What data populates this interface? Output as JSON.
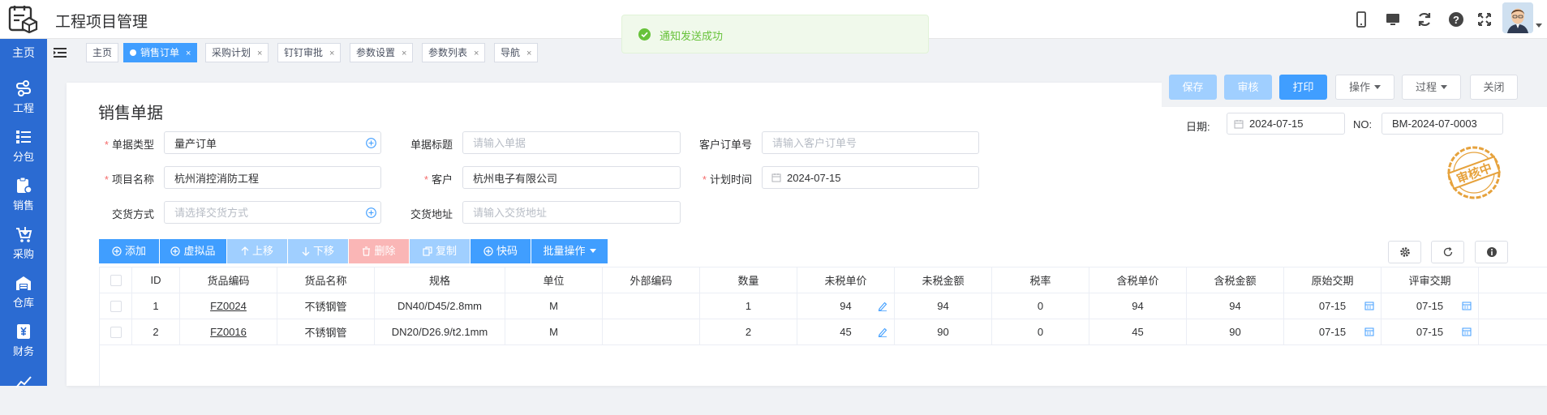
{
  "app": {
    "title": "工程项目管理"
  },
  "toast": {
    "message": "通知发送成功"
  },
  "sidebar": {
    "home": "主页",
    "items": [
      {
        "label": "工程",
        "icon": "project-icon"
      },
      {
        "label": "分包",
        "icon": "subcontract-icon"
      },
      {
        "label": "销售",
        "icon": "sales-icon"
      },
      {
        "label": "采购",
        "icon": "purchase-icon"
      },
      {
        "label": "仓库",
        "icon": "warehouse-icon"
      },
      {
        "label": "财务",
        "icon": "finance-icon"
      }
    ]
  },
  "tabs": [
    {
      "label": "主页",
      "closable": false,
      "active": false
    },
    {
      "label": "销售订单",
      "closable": true,
      "active": true
    },
    {
      "label": "采购计划",
      "closable": true,
      "active": false
    },
    {
      "label": "钉钉审批",
      "closable": true,
      "active": false
    },
    {
      "label": "参数设置",
      "closable": true,
      "active": false
    },
    {
      "label": "参数列表",
      "closable": true,
      "active": false
    },
    {
      "label": "导航",
      "closable": true,
      "active": false
    }
  ],
  "tab_close": "×",
  "actions": {
    "save": "保存",
    "audit": "审核",
    "print": "打印",
    "operate": "操作",
    "process": "过程",
    "close": "关闭"
  },
  "form": {
    "title": "销售单据",
    "doc_type_label": "单据类型",
    "doc_type_value": "量产订单",
    "doc_title_label": "单据标题",
    "doc_title_placeholder": "请输入单据",
    "customer_order_label": "客户订单号",
    "customer_order_placeholder": "请输入客户订单号",
    "project_label": "项目名称",
    "project_value": "杭州消控消防工程",
    "customer_label": "客户",
    "customer_value": "杭州电子有限公司",
    "plan_time_label": "计划时间",
    "plan_time_value": "2024-07-15",
    "delivery_method_label": "交货方式",
    "delivery_method_placeholder": "请选择交货方式",
    "delivery_address_label": "交货地址",
    "delivery_address_placeholder": "请输入交货地址",
    "date_label": "日期:",
    "date_value": "2024-07-15",
    "no_label": "NO:",
    "no_value": "BM-2024-07-0003",
    "required_mark": "*"
  },
  "stamp": {
    "text": "审核中"
  },
  "toolbar": {
    "add": "添加",
    "virtual": "虚拟品",
    "up": "上移",
    "down": "下移",
    "delete": "删除",
    "copy": "复制",
    "quick": "快码",
    "batch": "批量操作"
  },
  "grid": {
    "columns": [
      "ID",
      "货品编码",
      "货品名称",
      "规格",
      "单位",
      "外部编码",
      "数量",
      "未税单价",
      "未税金额",
      "税率",
      "含税单价",
      "含税金额",
      "原始交期",
      "评审交期"
    ],
    "rows": [
      {
        "id": "1",
        "code": "FZ0024",
        "name": "不锈钢管",
        "spec": "DN40/D45/2.8mm",
        "unit": "M",
        "ext": "",
        "qty": "1",
        "price": "94",
        "amount": "94",
        "tax": "0",
        "tax_price": "94",
        "tax_amount": "94",
        "orig_date": "07-15",
        "review_date": "07-15"
      },
      {
        "id": "2",
        "code": "FZ0016",
        "name": "不锈钢管",
        "spec": "DN20/D26.9/t2.1mm",
        "unit": "M",
        "ext": "",
        "qty": "2",
        "price": "45",
        "amount": "90",
        "tax": "0",
        "tax_price": "45",
        "tax_amount": "90",
        "orig_date": "07-15",
        "review_date": "07-15"
      }
    ]
  },
  "colors": {
    "primary": "#409eff",
    "sidebar": "#2b6bd2",
    "success": "#67c23a",
    "stamp": "#e6a23c",
    "required": "#f56c6c"
  }
}
